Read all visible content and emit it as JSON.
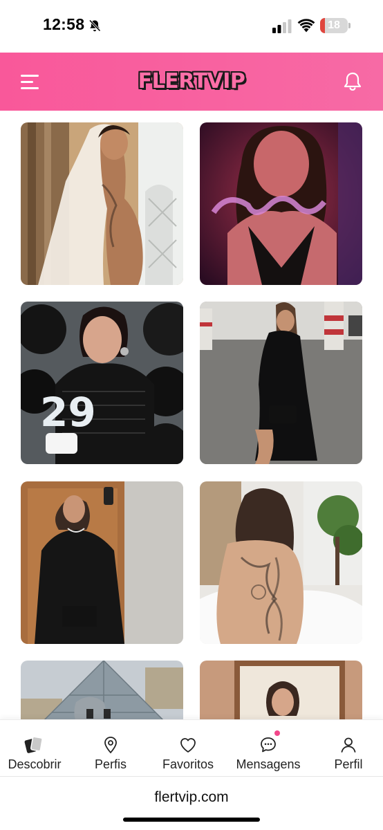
{
  "status_bar": {
    "time": "12:58",
    "battery_level": "18",
    "battery_fraction": 0.18,
    "mute_icon": "bell-slash-icon",
    "signal_icon": "cellular-signal-icon",
    "wifi_icon": "wifi-icon"
  },
  "header": {
    "logo_text": "FLERTVIP",
    "menu_icon": "hamburger-menu-icon",
    "notification_icon": "bell-icon",
    "background_color": "#f9589a",
    "logo_text_color": "#ff6fa8"
  },
  "grid": {
    "profiles": [
      {
        "label": "profile-photo-1"
      },
      {
        "label": "profile-photo-2"
      },
      {
        "label": "profile-photo-3"
      },
      {
        "label": "profile-photo-4"
      },
      {
        "label": "profile-photo-5"
      },
      {
        "label": "profile-photo-6"
      },
      {
        "label": "profile-photo-7"
      },
      {
        "label": "profile-photo-8"
      }
    ]
  },
  "bottom_nav": {
    "items": [
      {
        "label": "Descobrir",
        "icon": "cards-icon"
      },
      {
        "label": "Perfis",
        "icon": "map-pin-icon"
      },
      {
        "label": "Favoritos",
        "icon": "heart-icon"
      },
      {
        "label": "Mensagens",
        "icon": "chat-bubble-icon",
        "has_badge": true
      },
      {
        "label": "Perfil",
        "icon": "user-icon"
      }
    ],
    "badge_color": "#f2478a"
  },
  "browser": {
    "url": "flertvip.com"
  }
}
